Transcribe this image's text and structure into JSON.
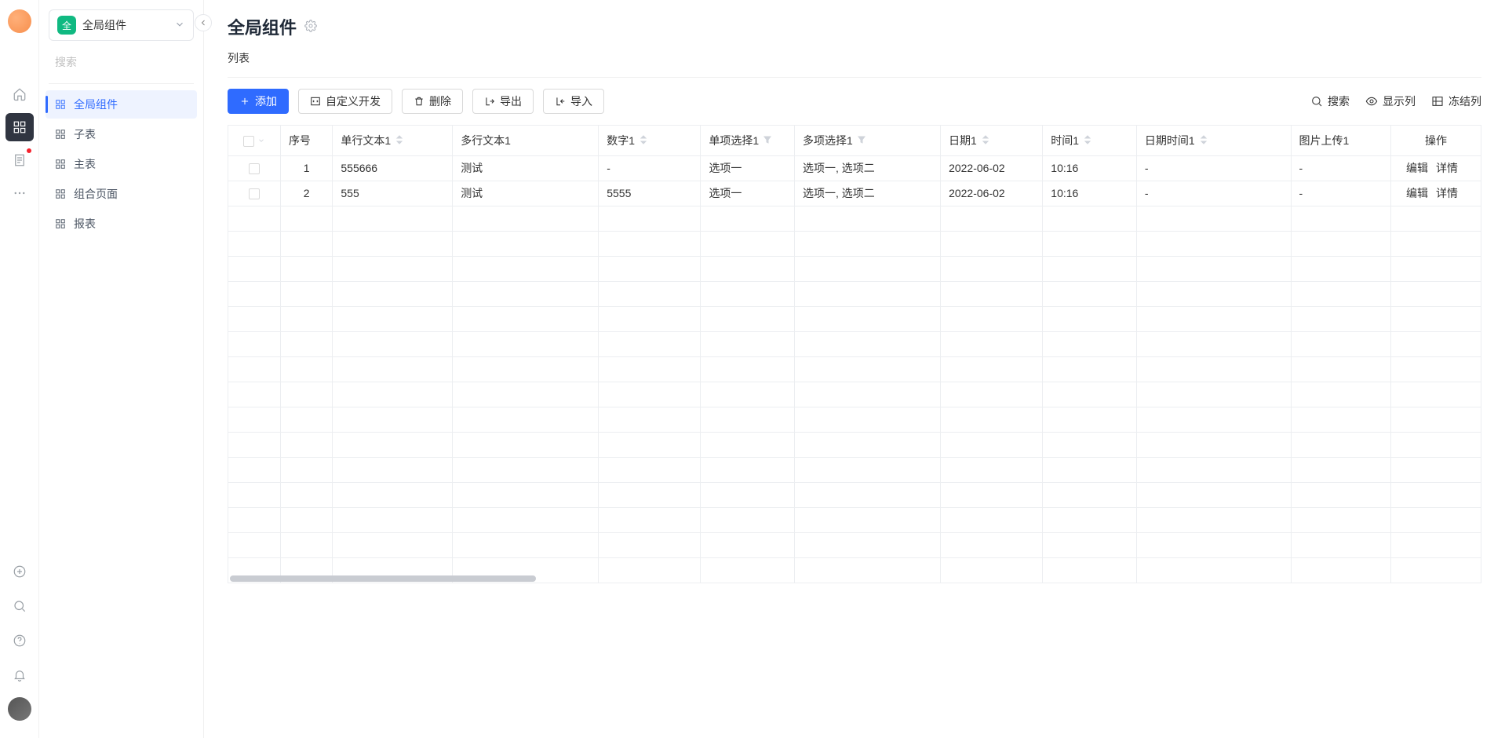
{
  "workspace": {
    "badge_text": "全",
    "name": "全局组件"
  },
  "sidebar": {
    "search_placeholder": "搜索",
    "items": [
      {
        "label": "全局组件",
        "active": true
      },
      {
        "label": "子表",
        "active": false
      },
      {
        "label": "主表",
        "active": false
      },
      {
        "label": "组合页面",
        "active": false
      },
      {
        "label": "报表",
        "active": false
      }
    ]
  },
  "page": {
    "title": "全局组件",
    "sub_title": "列表"
  },
  "toolbar": {
    "add": "添加",
    "custom_dev": "自定义开发",
    "delete": "删除",
    "export": "导出",
    "import": "导入",
    "search": "搜索",
    "columns": "显示列",
    "freeze": "冻结列"
  },
  "table": {
    "columns": {
      "seq": "序号",
      "single_text": "单行文本1",
      "multi_text": "多行文本1",
      "number": "数字1",
      "single_select": "单项选择1",
      "multi_select": "多项选择1",
      "date": "日期1",
      "time": "时间1",
      "datetime": "日期时间1",
      "image": "图片上传1",
      "ops": "操作"
    },
    "rows": [
      {
        "seq": "1",
        "single_text": "555666",
        "multi_text": "测试",
        "number": "-",
        "single_select": "选项一",
        "multi_select": "选项一, 选项二",
        "date": "2022-06-02",
        "time": "10:16",
        "datetime": "-",
        "image": "-"
      },
      {
        "seq": "2",
        "single_text": "555",
        "multi_text": "测试",
        "number": "5555",
        "single_select": "选项一",
        "multi_select": "选项一, 选项二",
        "date": "2022-06-02",
        "time": "10:16",
        "datetime": "-",
        "image": "-"
      }
    ],
    "empty_row_count": 15,
    "row_op": {
      "edit": "编辑",
      "detail": "详情"
    }
  }
}
